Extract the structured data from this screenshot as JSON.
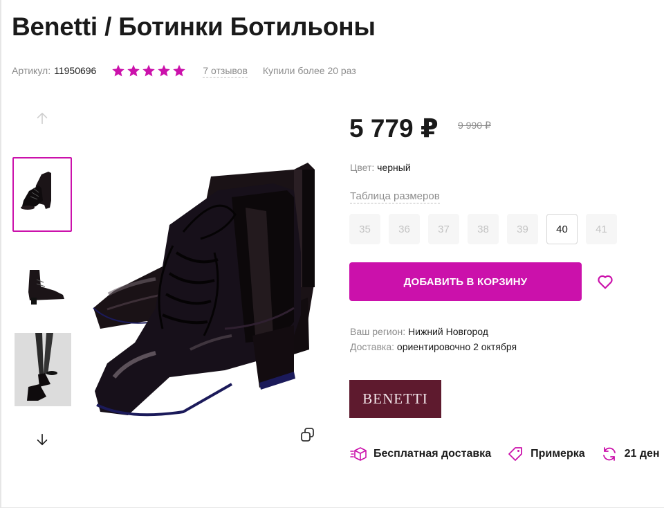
{
  "product": {
    "title": "Benetti / Ботинки Ботильоны",
    "sku_label": "Артикул:",
    "sku_value": "11950696",
    "rating": 5,
    "reviews": "7 отзывов",
    "bought": "Купили более 20 раз"
  },
  "gallery": {
    "up_icon": "arrow-up-icon",
    "down_icon": "arrow-down-icon",
    "active_index": 0
  },
  "pricing": {
    "price": "5 779 ₽",
    "old_price": "9 990 ₽"
  },
  "color": {
    "label": "Цвет:",
    "value": "черный"
  },
  "size_table_link": "Таблица размеров",
  "sizes": [
    {
      "label": "35",
      "available": false
    },
    {
      "label": "36",
      "available": false
    },
    {
      "label": "37",
      "available": false
    },
    {
      "label": "38",
      "available": false
    },
    {
      "label": "39",
      "available": false
    },
    {
      "label": "40",
      "available": true
    },
    {
      "label": "41",
      "available": false
    }
  ],
  "cart_button": "ДОБАВИТЬ В КОРЗИНУ",
  "delivery": {
    "region_label": "Ваш регион:",
    "region_value": "Нижний Новгород",
    "delivery_label": "Доставка:",
    "delivery_value": "ориентировочно 2 октября"
  },
  "brand": {
    "logo_text": "BENETTI"
  },
  "features": [
    {
      "icon": "delivery-box-icon",
      "label": "Бесплатная доставка"
    },
    {
      "icon": "tag-icon",
      "label": "Примерка"
    },
    {
      "icon": "return-icon",
      "label": "21 ден"
    }
  ],
  "colors": {
    "accent": "#cb11ab",
    "brand_bg": "#5e1a2e"
  }
}
